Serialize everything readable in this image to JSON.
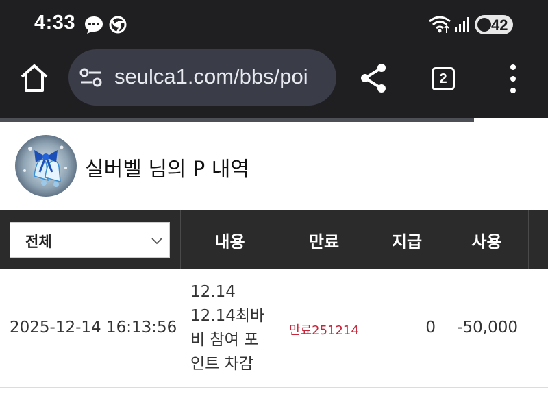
{
  "status_bar": {
    "time": "4:33",
    "battery": "42",
    "icons": [
      "message-icon",
      "chrome-icon",
      "wifi-icon",
      "signal-icon",
      "battery-saver-icon"
    ]
  },
  "browser": {
    "url": "seulca1.com/bbs/poi",
    "tab_count": "2",
    "icons": [
      "home-icon",
      "site-settings-icon",
      "share-icon",
      "tabs-icon",
      "more-vert-icon"
    ],
    "load_progress": 0.865
  },
  "page": {
    "title": "실버벨 님의 P 내역",
    "avatar": "bell-avatar"
  },
  "table": {
    "filter_value": "전체",
    "headers": [
      "내용",
      "만료",
      "지급",
      "사용"
    ],
    "rows": [
      {
        "date": "2025-12-14 16:13:56",
        "desc_lines": [
          "12.14",
          "12.14최바",
          "비 참여 포",
          "인트 차감"
        ],
        "expire": "만료251214",
        "give": "0",
        "use": "-50,000"
      }
    ]
  },
  "colors": {
    "chrome_bg": "#1f1f22",
    "omnibox_bg": "#3a3d48",
    "table_header_bg": "#2b2b2b",
    "expire_text": "#c8243a"
  }
}
